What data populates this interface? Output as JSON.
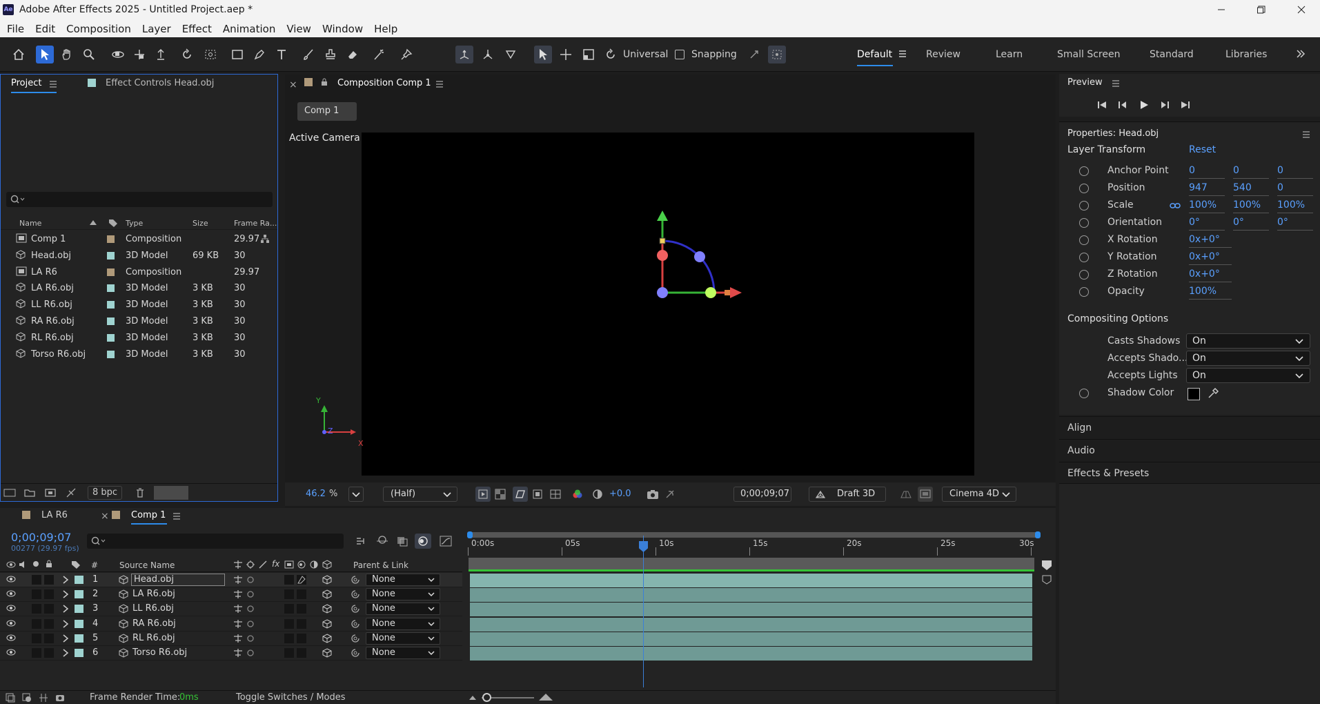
{
  "app": {
    "title": "Adobe After Effects 2025 - Untitled Project.aep *",
    "logo": "Ae"
  },
  "menu": [
    "File",
    "Edit",
    "Composition",
    "Layer",
    "Effect",
    "Animation",
    "View",
    "Window",
    "Help"
  ],
  "toolbar": {
    "axis_mode": "Universal",
    "snapping": "Snapping"
  },
  "workspaces": [
    "Default",
    "Review",
    "Learn",
    "Small Screen",
    "Standard",
    "Libraries"
  ],
  "project": {
    "tab_project": "Project",
    "tab_effect": "Effect Controls Head.obj",
    "columns": {
      "name": "Name",
      "type": "Type",
      "size": "Size",
      "frame_rate": "Frame Ra..."
    },
    "items": [
      {
        "name": "Comp 1",
        "type": "Composition",
        "size": "",
        "fps": "29.97"
      },
      {
        "name": "Head.obj",
        "type": "3D Model",
        "size": "69 KB",
        "fps": "30"
      },
      {
        "name": "LA R6",
        "type": "Composition",
        "size": "",
        "fps": "29.97"
      },
      {
        "name": "LA R6.obj",
        "type": "3D Model",
        "size": "3 KB",
        "fps": "30"
      },
      {
        "name": "LL R6.obj",
        "type": "3D Model",
        "size": "3 KB",
        "fps": "30"
      },
      {
        "name": "RA R6.obj",
        "type": "3D Model",
        "size": "3 KB",
        "fps": "30"
      },
      {
        "name": "RL R6.obj",
        "type": "3D Model",
        "size": "3 KB",
        "fps": "30"
      },
      {
        "name": "Torso R6.obj",
        "type": "3D Model",
        "size": "3 KB",
        "fps": "30"
      }
    ],
    "bpc": "8 bpc"
  },
  "composition": {
    "tab": "Composition Comp 1",
    "comp_button": "Comp 1",
    "camera": "Active Camera (Default)",
    "zoom": "46.2",
    "zoom_unit": "%",
    "resolution": "(Half)",
    "exposure": "+0.0",
    "timecode": "0;00;09;07",
    "renderer_button": "Draft 3D",
    "renderer": "Cinema 4D",
    "axis_labels": {
      "x": "X",
      "y": "Y",
      "z": "Z"
    }
  },
  "preview": {
    "title": "Preview"
  },
  "properties": {
    "title": "Properties: Head.obj",
    "layer_transform": "Layer Transform",
    "reset": "Reset",
    "rows": [
      {
        "label": "Anchor Point",
        "v1": "0",
        "v2": "0",
        "v3": "0"
      },
      {
        "label": "Position",
        "v1": "947",
        "v2": "540",
        "v3": "0"
      },
      {
        "label": "Scale",
        "v1": "100%",
        "v2": "100%",
        "v3": "100%"
      },
      {
        "label": "Orientation",
        "v1": "0°",
        "v2": "0°",
        "v3": "0°"
      },
      {
        "label": "X Rotation",
        "v1": "0x+0°"
      },
      {
        "label": "Y Rotation",
        "v1": "0x+0°"
      },
      {
        "label": "Z Rotation",
        "v1": "0x+0°"
      },
      {
        "label": "Opacity",
        "v1": "100%"
      }
    ],
    "compositing": "Compositing Options",
    "casts_shadows": {
      "label": "Casts Shadows",
      "value": "On"
    },
    "accepts_shadows": {
      "label": "Accepts Shado...",
      "value": "On"
    },
    "accepts_lights": {
      "label": "Accepts Lights",
      "value": "On"
    },
    "shadow_color": {
      "label": "Shadow Color"
    }
  },
  "sections": [
    "Align",
    "Audio",
    "Effects & Presets"
  ],
  "timeline": {
    "tabs": [
      "LA R6",
      "Comp 1"
    ],
    "timecode": "0;00;09;07",
    "frames": "00277 (29.97 fps)",
    "ruler": [
      "0:00s",
      "05s",
      "10s",
      "15s",
      "20s",
      "25s",
      "30s"
    ],
    "columns": {
      "num": "#",
      "source": "Source Name",
      "parent": "Parent & Link"
    },
    "layers": [
      {
        "num": "1",
        "name": "Head.obj",
        "parent": "None"
      },
      {
        "num": "2",
        "name": "LA R6.obj",
        "parent": "None"
      },
      {
        "num": "3",
        "name": "LL R6.obj",
        "parent": "None"
      },
      {
        "num": "4",
        "name": "RA R6.obj",
        "parent": "None"
      },
      {
        "num": "5",
        "name": "RL R6.obj",
        "parent": "None"
      },
      {
        "num": "6",
        "name": "Torso R6.obj",
        "parent": "None"
      }
    ]
  },
  "status": {
    "render_label": "Frame Render Time:",
    "render_value": "0ms",
    "toggle": "Toggle Switches / Modes"
  },
  "colors": {
    "accent": "#2d8ceb",
    "comp_label": "#b09a7a",
    "model_label": "#9fd3d0",
    "layer_bar": "#6f9a95"
  }
}
